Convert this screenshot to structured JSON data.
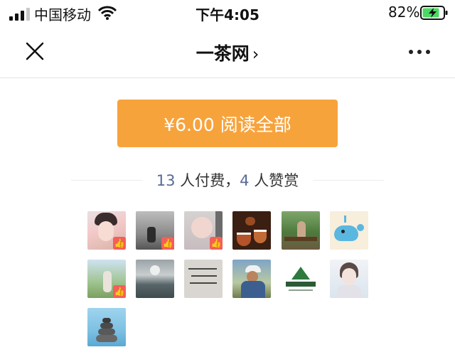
{
  "status_bar": {
    "carrier": "中国移动",
    "time": "下午4:05",
    "battery_pct": "82%",
    "battery_level": 0.82,
    "charging": true
  },
  "nav": {
    "title": "一茶网",
    "chevron": "›",
    "close_icon": "close-icon",
    "more_icon": "more-icon"
  },
  "pay": {
    "label": "¥6.00 阅读全部"
  },
  "summary": {
    "paid_count": "13",
    "paid_text": " 人付费，",
    "reward_count": "4",
    "reward_text": " 人赞赏"
  },
  "colors": {
    "accent": "#f7a33c",
    "link": "#576b95",
    "badge": "#f45f56"
  },
  "avatars": [
    {
      "name": "avatar-user-1",
      "liked": true
    },
    {
      "name": "avatar-user-2",
      "liked": true
    },
    {
      "name": "avatar-user-3",
      "liked": true
    },
    {
      "name": "avatar-user-4",
      "liked": false
    },
    {
      "name": "avatar-user-5",
      "liked": false
    },
    {
      "name": "avatar-user-6",
      "liked": false
    },
    {
      "name": "avatar-user-7",
      "liked": true
    },
    {
      "name": "avatar-user-8",
      "liked": false
    },
    {
      "name": "avatar-user-9",
      "liked": false
    },
    {
      "name": "avatar-user-10",
      "liked": false
    },
    {
      "name": "avatar-user-11",
      "liked": false
    },
    {
      "name": "avatar-user-12",
      "liked": false
    },
    {
      "name": "avatar-user-13",
      "liked": false
    }
  ]
}
